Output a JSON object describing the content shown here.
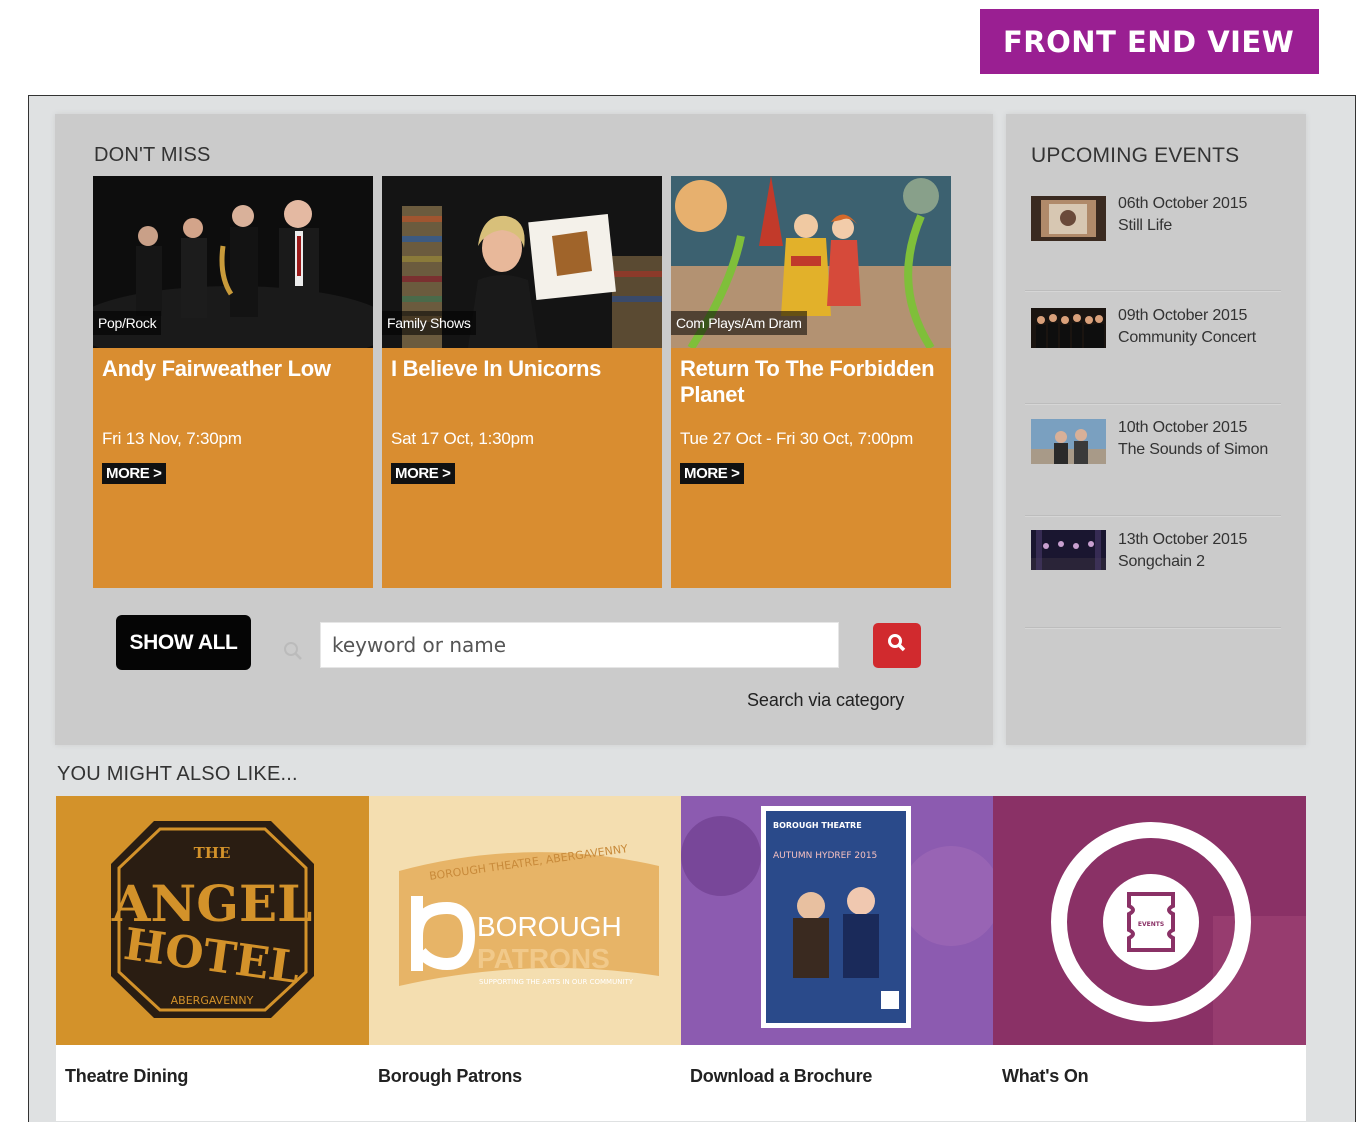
{
  "banner": {
    "label": "FRONT END VIEW"
  },
  "dont_miss": {
    "title": "DON'T MISS",
    "cards": [
      {
        "category": "Pop/Rock",
        "title": "Andy Fairweather Low",
        "date": "Fri 13 Nov, 7:30pm",
        "more": "MORE >"
      },
      {
        "category": "Family Shows",
        "title": "I Believe In Unicorns",
        "date": "Sat 17 Oct, 1:30pm",
        "more": "MORE >"
      },
      {
        "category": "Com Plays/Am Dram",
        "title": "Return To The Forbidden Planet",
        "date": "Tue 27 Oct - Fri 30 Oct, 7:00pm",
        "more": "MORE >"
      }
    ],
    "show_all_label": "SHOW ALL",
    "search_placeholder": "keyword or name",
    "search_category_link": "Search via category"
  },
  "upcoming": {
    "title": "UPCOMING EVENTS",
    "items": [
      {
        "date": "06th October 2015",
        "name": "Still Life"
      },
      {
        "date": "09th October 2015",
        "name": "Community Concert"
      },
      {
        "date": "10th October 2015",
        "name": "The Sounds of Simon"
      },
      {
        "date": "13th October 2015",
        "name": "Songchain 2"
      }
    ]
  },
  "also_like": {
    "title": "YOU MIGHT ALSO LIKE...",
    "tiles": [
      {
        "label": "Theatre Dining",
        "image_text": {
          "top": "THE",
          "l1": "ANGEL",
          "l2": "HOTEL",
          "bottom": "ABERGAVENNY"
        }
      },
      {
        "label": "Borough Patrons",
        "image_text": {
          "arc": "BOROUGH THEATRE, ABERGAVENNY",
          "l1": "BOROUGH",
          "l2": "PATRONS",
          "tag": "SUPPORTING THE ARTS IN OUR COMMUNITY"
        }
      },
      {
        "label": "Download a Brochure",
        "image_text": {
          "header": "BOROUGH THEATRE",
          "season": "AUTUMN HYDREF 2015"
        }
      },
      {
        "label": "What's On",
        "image_text": {
          "icon": "EVENTS"
        }
      }
    ]
  },
  "colors": {
    "banner": "#9a1f92",
    "card": "#d98d30",
    "search_button": "#d12a2e",
    "panel": "#cbcbcb"
  }
}
